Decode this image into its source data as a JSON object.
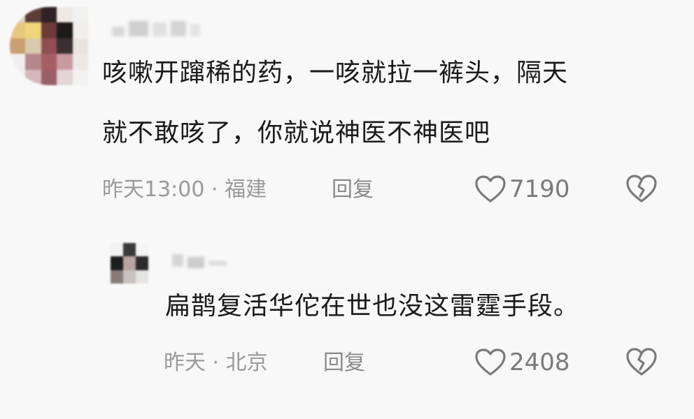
{
  "comment": {
    "text_line1": "咳嗽开蹿稀的药，一咳就拉一裤头，隔天",
    "text_line2": "就不敢咳了，你就说神医不神医吧",
    "meta": "昨天13:00 · 福建",
    "reply_label": "回复",
    "like_count": "7190",
    "like_icon": "heart-outline-icon",
    "dislike_icon": "broken-heart-icon"
  },
  "reply": {
    "text": "扁鹊复活华佗在世也没这雷霆手段。",
    "meta": "昨天 · 北京",
    "reply_label": "回复",
    "like_count": "2408",
    "like_icon": "heart-outline-icon",
    "dislike_icon": "broken-heart-icon"
  },
  "colors": {
    "text": "#1a1a1a",
    "meta": "#9a9a9a",
    "icon": "#7a7a7a",
    "background": "#f8f8f8"
  }
}
